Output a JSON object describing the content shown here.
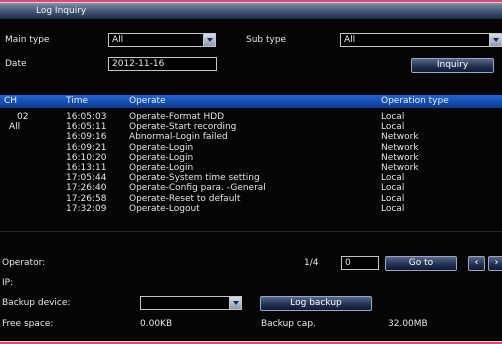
{
  "window": {
    "title": "Log Inquiry"
  },
  "filters": {
    "main_type_label": "Main type",
    "main_type_value": "All",
    "sub_type_label": "Sub type",
    "sub_type_value": "All",
    "date_label": "Date",
    "date_value": "2012-11-16",
    "inquiry_label": "Inquiry"
  },
  "table": {
    "columns": [
      "CH",
      "Time",
      "Operate",
      "Operation type"
    ],
    "channels": [
      "02",
      "All"
    ],
    "rows": [
      {
        "time": "16:05:03",
        "operate": "Operate-Format HDD",
        "type": "Local"
      },
      {
        "time": "16:05:11",
        "operate": "Operate-Start recording",
        "type": "Local"
      },
      {
        "time": "16:09:16",
        "operate": "Abnormal-Login failed",
        "type": "Network"
      },
      {
        "time": "16:09:21",
        "operate": "Operate-Login",
        "type": "Network"
      },
      {
        "time": "16:10:20",
        "operate": "Operate-Login",
        "type": "Network"
      },
      {
        "time": "16:13:11",
        "operate": "Operate-Login",
        "type": "Network"
      },
      {
        "time": "17:05:44",
        "operate": "Operate-System time setting",
        "type": "Local"
      },
      {
        "time": "17:26:40",
        "operate": "Operate-Config para. -General",
        "type": "Local"
      },
      {
        "time": "17:26:58",
        "operate": "Operate-Reset to default",
        "type": "Local"
      },
      {
        "time": "17:32:09",
        "operate": "Operate-Logout",
        "type": "Local"
      }
    ]
  },
  "footer": {
    "operator_label": "Operator:",
    "ip_label": "IP:",
    "page_indicator": "1/4",
    "page_input": "0",
    "goto_label": "Go to",
    "prev_icon": "chevron-left-icon",
    "next_icon": "chevron-right-icon",
    "backup_device_label": "Backup device:",
    "backup_device_value": "",
    "log_backup_label": "Log backup",
    "free_space_label": "Free space:",
    "free_space_value": "0.00KB",
    "backup_cap_label": "Backup cap.",
    "backup_cap_value": "32.00MB"
  },
  "colors": {
    "header_blue": "#1a5ac8",
    "title_gradient": "#4a5a78",
    "background": "#050505",
    "accent_pink": "#e0457e"
  }
}
